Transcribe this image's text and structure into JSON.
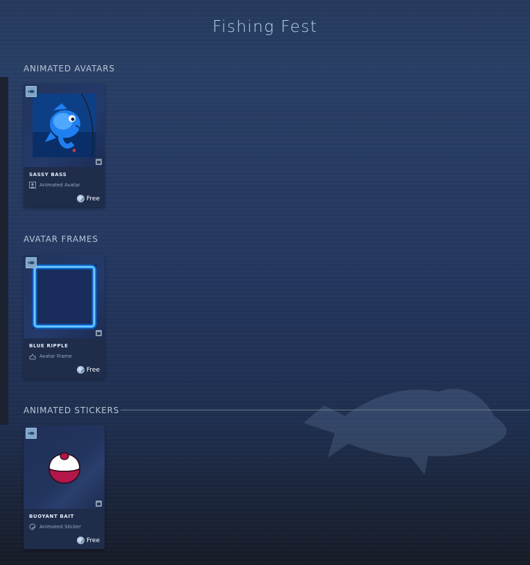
{
  "page": {
    "title": "Fishing Fest"
  },
  "sections": [
    {
      "label": "ANIMATED AVATARS",
      "item": {
        "name": "SASSY BASS",
        "type": "Animated Avatar",
        "price": "Free",
        "game_icon": "fish-game-icon",
        "type_icon": "avatar-icon"
      }
    },
    {
      "label": "AVATAR FRAMES",
      "item": {
        "name": "BLUE RIPPLE",
        "type": "Avatar Frame",
        "price": "Free",
        "game_icon": "fish-game-icon",
        "type_icon": "frame-icon"
      }
    },
    {
      "label": "ANIMATED STICKERS",
      "item": {
        "name": "BUOYANT BAIT",
        "type": "Animated Sticker",
        "price": "Free",
        "game_icon": "fish-game-icon",
        "type_icon": "sticker-icon"
      }
    }
  ],
  "colors": {
    "accent_blue": "#1e90ff",
    "frame_glow": "#27a2ff",
    "bait_red": "#b3174a"
  }
}
